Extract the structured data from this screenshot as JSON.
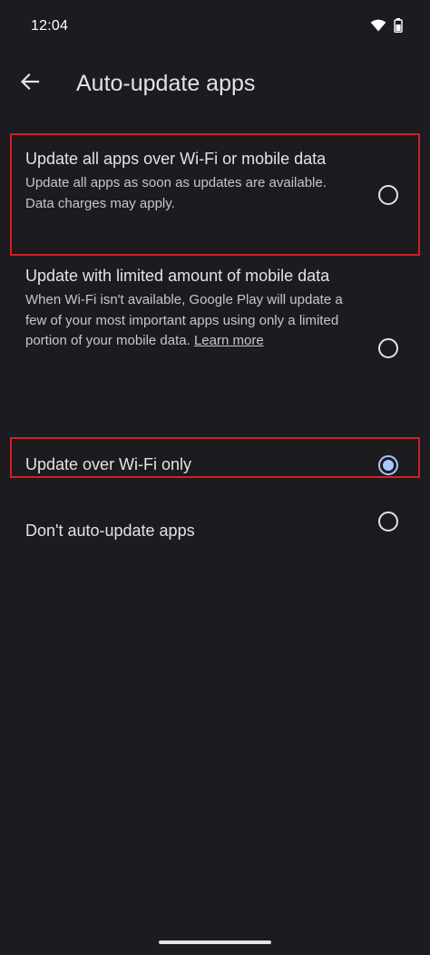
{
  "status_bar": {
    "time": "12:04",
    "icons": [
      "wifi-icon",
      "battery-icon"
    ]
  },
  "header": {
    "back_icon": "arrow-left-icon",
    "title": "Auto-update apps"
  },
  "options": [
    {
      "title": "Update all apps over Wi-Fi or mobile data",
      "description": "Update all apps as soon as updates are available. Data charges may apply.",
      "selected": false
    },
    {
      "title": "Update with limited amount of mobile data",
      "description": "When Wi-Fi isn't available, Google Play will update a few of your most important apps using only a limited portion of your mobile data.",
      "link_text": "Learn more",
      "selected": false
    },
    {
      "title": "Update over Wi-Fi only",
      "selected": true
    },
    {
      "title": "Don't auto-update apps",
      "selected": false
    }
  ],
  "colors": {
    "background": "#1c1b1f",
    "text_primary": "#e6e1e5",
    "text_secondary": "#c9c5ca",
    "radio_selected": "#a8c7fa",
    "highlight_box": "#d21f26"
  }
}
